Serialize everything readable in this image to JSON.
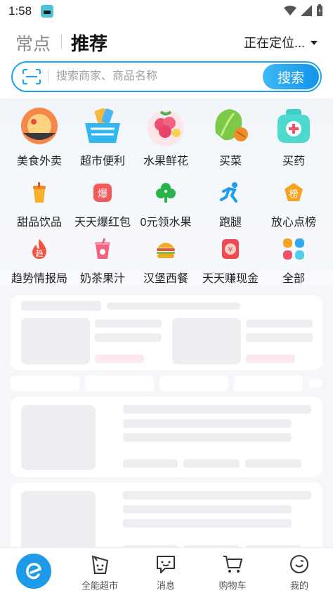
{
  "status_bar": {
    "time": "1:58"
  },
  "header": {
    "tab_frequent": "常点",
    "tab_recommend": "推荐",
    "location": "正在定位..."
  },
  "search": {
    "placeholder": "搜索商家、商品名称",
    "button_label": "搜索"
  },
  "categories": [
    {
      "label": "美食外卖",
      "icon": "food-delivery-icon"
    },
    {
      "label": "超市便利",
      "icon": "supermarket-basket-icon"
    },
    {
      "label": "水果鲜花",
      "icon": "fruit-flower-icon"
    },
    {
      "label": "买菜",
      "icon": "vegetable-icon"
    },
    {
      "label": "买药",
      "icon": "medicine-kit-icon"
    },
    {
      "label": "甜品饮品",
      "icon": "dessert-drink-icon"
    },
    {
      "label": "天天爆红包",
      "icon": "red-packet-icon",
      "icon_text": "爆"
    },
    {
      "label": "0元领水果",
      "icon": "free-fruit-tree-icon"
    },
    {
      "label": "跑腿",
      "icon": "errand-runner-icon"
    },
    {
      "label": "放心点榜",
      "icon": "ranking-badge-icon",
      "icon_text": "榜"
    },
    {
      "label": "趋势情报局",
      "icon": "trend-fire-icon",
      "icon_text": "趋"
    },
    {
      "label": "奶茶果汁",
      "icon": "milk-tea-icon"
    },
    {
      "label": "汉堡西餐",
      "icon": "burger-icon"
    },
    {
      "label": "天天赚现金",
      "icon": "cash-envelope-icon",
      "icon_text": "¥"
    },
    {
      "label": "全部",
      "icon": "all-grid-icon"
    }
  ],
  "bottom_nav": [
    {
      "label": "",
      "icon": "eleme-home-icon"
    },
    {
      "label": "全能超市",
      "icon": "supermarket-bag-icon"
    },
    {
      "label": "消息",
      "icon": "message-icon"
    },
    {
      "label": "购物车",
      "icon": "cart-icon"
    },
    {
      "label": "我的",
      "icon": "profile-icon"
    }
  ],
  "colors": {
    "accent": "#1aa0f0",
    "search_button": "#1293ea",
    "skeleton": "#eceef1"
  }
}
